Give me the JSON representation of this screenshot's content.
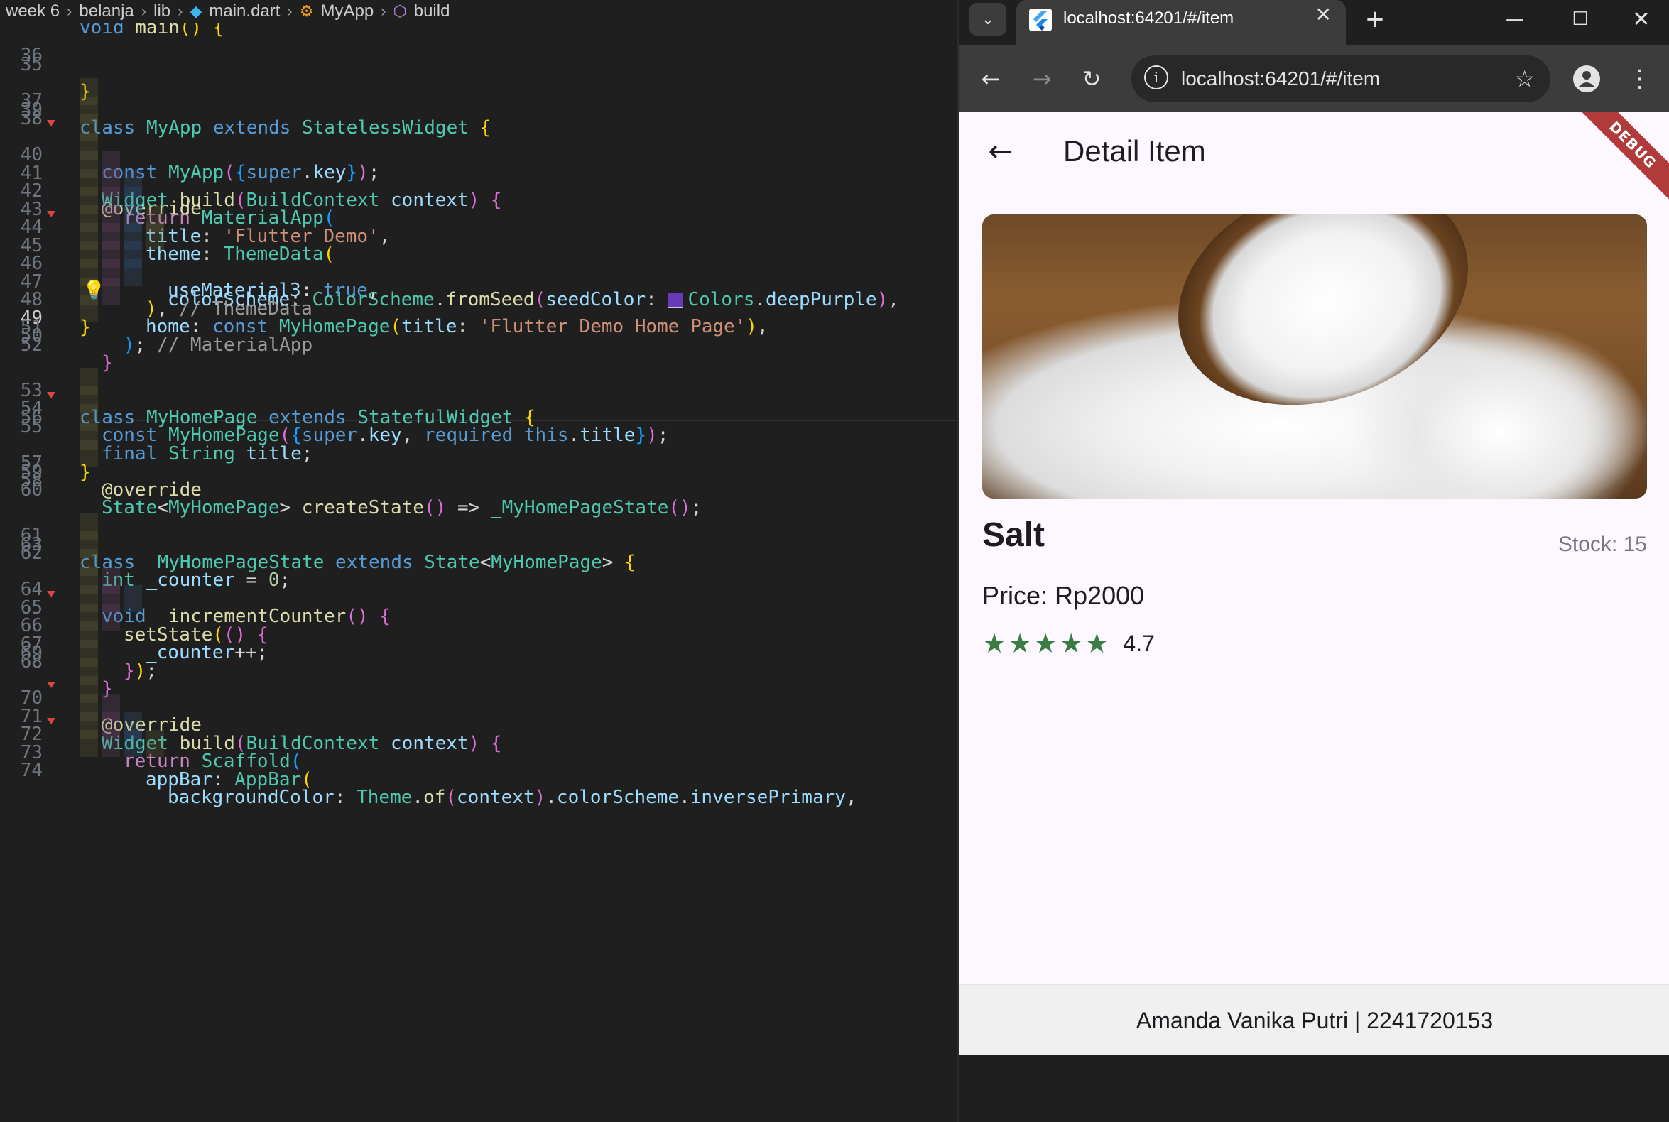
{
  "breadcrumb": {
    "items": [
      "week 6",
      "belanja",
      "lib",
      "main.dart",
      "MyApp",
      "build"
    ]
  },
  "editor": {
    "first_line_partial": "void main() {",
    "lines": [
      {
        "n": "35",
        "text": "}"
      },
      {
        "n": "36",
        "text": ""
      },
      {
        "n": "37",
        "text": "class MyApp extends StatelessWidget {"
      },
      {
        "n": "38",
        "text": "const MyApp({super.key});"
      },
      {
        "n": "39",
        "text": ""
      },
      {
        "n": "40",
        "text": "@override"
      },
      {
        "n": "41",
        "text": "Widget build(BuildContext context) {"
      },
      {
        "n": "42",
        "text": "return MaterialApp("
      },
      {
        "n": "43",
        "text": "title: 'Flutter Demo',"
      },
      {
        "n": "44",
        "text": "theme: ThemeData("
      },
      {
        "n": "45",
        "text": "colorScheme: ColorScheme.fromSeed(seedColor: Colors.deepPurple),"
      },
      {
        "n": "46",
        "text": "useMaterial3: true,"
      },
      {
        "n": "47",
        "text": "), // ThemeData"
      },
      {
        "n": "48",
        "text": "home: const MyHomePage(title: 'Flutter Demo Home Page'),"
      },
      {
        "n": "49",
        "text": "); // MaterialApp"
      },
      {
        "n": "50",
        "text": "}"
      },
      {
        "n": "51",
        "text": "}"
      },
      {
        "n": "52",
        "text": ""
      },
      {
        "n": "53",
        "text": "class MyHomePage extends StatefulWidget {"
      },
      {
        "n": "54",
        "text": "const MyHomePage({super.key, required this.title});"
      },
      {
        "n": "55",
        "text": "final String title;"
      },
      {
        "n": "56",
        "text": ""
      },
      {
        "n": "57",
        "text": "@override"
      },
      {
        "n": "58",
        "text": "State<MyHomePage> createState() => _MyHomePageState();"
      },
      {
        "n": "59",
        "text": "}"
      },
      {
        "n": "60",
        "text": ""
      },
      {
        "n": "61",
        "text": "class _MyHomePageState extends State<MyHomePage> {"
      },
      {
        "n": "62",
        "text": "int _counter = 0;"
      },
      {
        "n": "63",
        "text": ""
      },
      {
        "n": "64",
        "text": "void _incrementCounter() {"
      },
      {
        "n": "65",
        "text": "setState(() {"
      },
      {
        "n": "66",
        "text": "_counter++;"
      },
      {
        "n": "67",
        "text": "});"
      },
      {
        "n": "68",
        "text": "}"
      },
      {
        "n": "69",
        "text": ""
      },
      {
        "n": "70",
        "text": "@override"
      },
      {
        "n": "71",
        "text": "Widget build(BuildContext context) {"
      },
      {
        "n": "72",
        "text": "return Scaffold("
      },
      {
        "n": "73",
        "text": "appBar: AppBar("
      },
      {
        "n": "74",
        "text": "backgroundColor: Theme.of(context).colorScheme.inversePrimary,"
      }
    ],
    "current_line": "49",
    "swatch_color": "#673ab7"
  },
  "browser": {
    "tab_title": "localhost:64201/#/item",
    "url": "localhost:64201/#/item",
    "icons": {
      "tab_list": "chevron-down-icon",
      "close_tab": "close-icon",
      "new_tab": "plus-icon",
      "back": "arrow-left-icon",
      "forward": "arrow-right-icon",
      "reload": "reload-icon",
      "site_info": "info-icon",
      "bookmark": "star-icon",
      "profile": "person-icon",
      "menu": "kebab-menu-icon"
    }
  },
  "app": {
    "title": "Detail Item",
    "debug_banner": "DEBUG",
    "item": {
      "name": "Salt",
      "stock": "Stock: 15",
      "price": "Price: Rp2000",
      "rating": "4.7",
      "stars": 5,
      "image": "salt-in-wooden-spoon"
    },
    "footer": "Amanda Vanika Putri | 2241720153",
    "colors": {
      "background": "#fdf7ff",
      "star": "#3a7d44",
      "debug": "#b13a3a"
    }
  }
}
